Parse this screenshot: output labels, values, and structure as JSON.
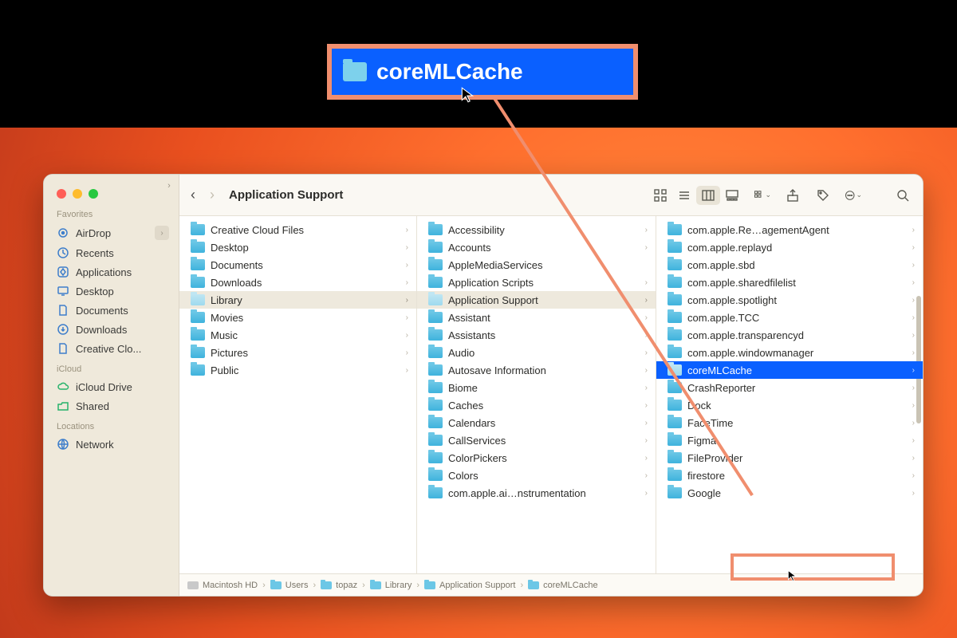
{
  "callout": {
    "label": "coreMLCache"
  },
  "window": {
    "title": "Application Support",
    "lights": [
      "close",
      "minimize",
      "zoom"
    ]
  },
  "sidebar": {
    "sections": {
      "favorites": {
        "label": "Favorites",
        "items": [
          "AirDrop",
          "Recents",
          "Applications",
          "Desktop",
          "Documents",
          "Downloads",
          "Creative Clo..."
        ]
      },
      "icloud": {
        "label": "iCloud",
        "items": [
          "iCloud Drive",
          "Shared"
        ]
      },
      "locations": {
        "label": "Locations",
        "items": [
          "Network"
        ]
      }
    }
  },
  "columns": {
    "col1": [
      {
        "name": "Creative Cloud Files",
        "chev": true
      },
      {
        "name": "Desktop",
        "chev": true
      },
      {
        "name": "Documents",
        "chev": true
      },
      {
        "name": "Downloads",
        "chev": true
      },
      {
        "name": "Library",
        "chev": true,
        "pathSelected": true
      },
      {
        "name": "Movies",
        "chev": true
      },
      {
        "name": "Music",
        "chev": true
      },
      {
        "name": "Pictures",
        "chev": true
      },
      {
        "name": "Public",
        "chev": true
      }
    ],
    "col2": [
      {
        "name": "Accessibility",
        "chev": true
      },
      {
        "name": "Accounts",
        "chev": true
      },
      {
        "name": "AppleMediaServices"
      },
      {
        "name": "Application Scripts",
        "chev": true
      },
      {
        "name": "Application Support",
        "chev": true,
        "pathSelected": true
      },
      {
        "name": "Assistant",
        "chev": true
      },
      {
        "name": "Assistants",
        "chev": true
      },
      {
        "name": "Audio",
        "chev": true
      },
      {
        "name": "Autosave Information",
        "chev": true
      },
      {
        "name": "Biome",
        "chev": true
      },
      {
        "name": "Caches",
        "chev": true
      },
      {
        "name": "Calendars",
        "chev": true
      },
      {
        "name": "CallServices",
        "chev": true
      },
      {
        "name": "ColorPickers",
        "chev": true
      },
      {
        "name": "Colors",
        "chev": true
      },
      {
        "name": "com.apple.ai…nstrumentation",
        "chev": true
      }
    ],
    "col3": [
      {
        "name": "com.apple.Re…agementAgent",
        "chev": true
      },
      {
        "name": "com.apple.replayd",
        "chev": true
      },
      {
        "name": "com.apple.sbd",
        "chev": true
      },
      {
        "name": "com.apple.sharedfilelist",
        "chev": true
      },
      {
        "name": "com.apple.spotlight",
        "chev": true
      },
      {
        "name": "com.apple.TCC",
        "chev": true
      },
      {
        "name": "com.apple.transparencyd",
        "chev": true
      },
      {
        "name": "com.apple.windowmanager",
        "chev": true
      },
      {
        "name": "coreMLCache",
        "chev": true,
        "blueSelected": true
      },
      {
        "name": "CrashReporter",
        "chev": true
      },
      {
        "name": "Dock",
        "chev": true
      },
      {
        "name": "FaceTime",
        "chev": true
      },
      {
        "name": "Figma",
        "chev": true
      },
      {
        "name": "FileProvider",
        "chev": true
      },
      {
        "name": "firestore",
        "chev": true
      },
      {
        "name": "Google",
        "chev": true
      }
    ]
  },
  "path": [
    "Macintosh HD",
    "Users",
    "topaz",
    "Library",
    "Application Support",
    "coreMLCache"
  ]
}
